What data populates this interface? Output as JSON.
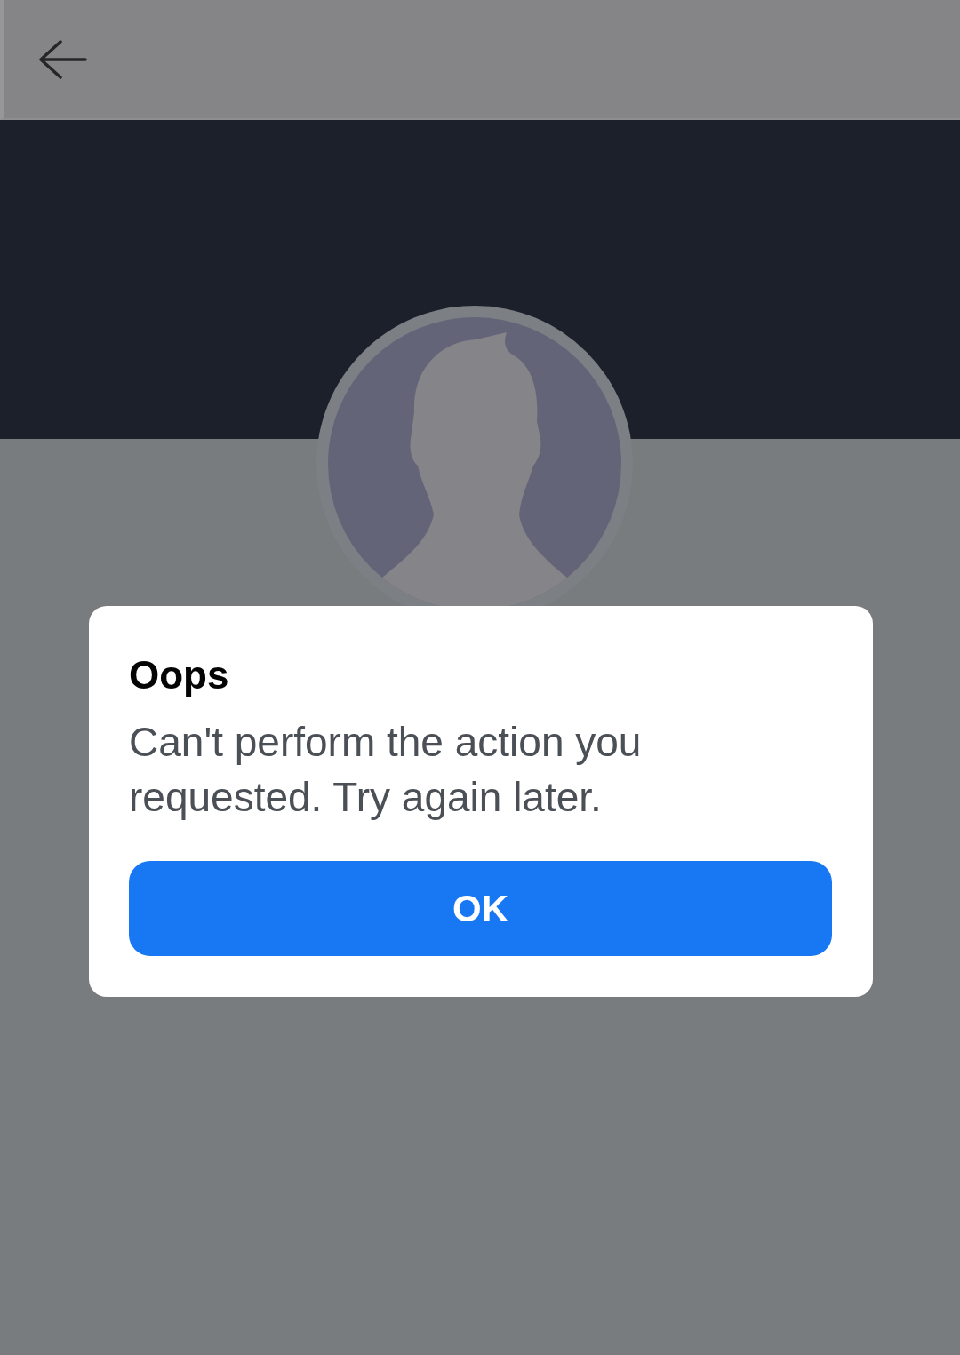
{
  "dialog": {
    "title": "Oops",
    "message": "Can't perform the action you requested. Try again later.",
    "button": "OK"
  }
}
